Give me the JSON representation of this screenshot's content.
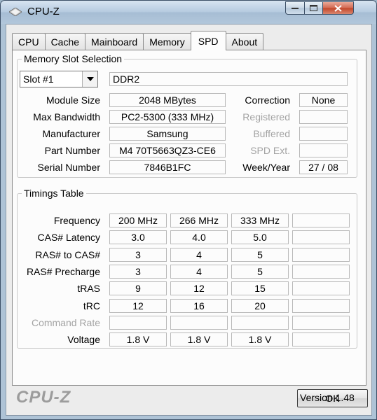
{
  "window": {
    "title": "CPU-Z",
    "controls": {
      "minimize": "—",
      "maximize": "□",
      "close": "✕"
    }
  },
  "tabs": [
    "CPU",
    "Cache",
    "Mainboard",
    "Memory",
    "SPD",
    "About"
  ],
  "active_tab": "SPD",
  "slot_section": {
    "title": "Memory Slot Selection",
    "slot_selected": "Slot #1",
    "slot_type": "DDR2",
    "fields": {
      "module_size_label": "Module Size",
      "module_size": "2048 MBytes",
      "max_bandwidth_label": "Max Bandwidth",
      "max_bandwidth": "PC2-5300 (333 MHz)",
      "manufacturer_label": "Manufacturer",
      "manufacturer": "Samsung",
      "part_number_label": "Part Number",
      "part_number": "M4 70T5663QZ3-CE6",
      "serial_number_label": "Serial Number",
      "serial_number": "7846B1FC",
      "correction_label": "Correction",
      "correction": "None",
      "registered_label": "Registered",
      "registered": "",
      "buffered_label": "Buffered",
      "buffered": "",
      "spd_ext_label": "SPD Ext.",
      "spd_ext": "",
      "week_year_label": "Week/Year",
      "week_year": "27 / 08"
    }
  },
  "timings": {
    "title": "Timings Table",
    "rows": [
      {
        "label": "Frequency",
        "values": [
          "200 MHz",
          "266 MHz",
          "333 MHz",
          ""
        ],
        "dim": false
      },
      {
        "label": "CAS# Latency",
        "values": [
          "3.0",
          "4.0",
          "5.0",
          ""
        ],
        "dim": false
      },
      {
        "label": "RAS# to CAS#",
        "values": [
          "3",
          "4",
          "5",
          ""
        ],
        "dim": false
      },
      {
        "label": "RAS# Precharge",
        "values": [
          "3",
          "4",
          "5",
          ""
        ],
        "dim": false
      },
      {
        "label": "tRAS",
        "values": [
          "9",
          "12",
          "15",
          ""
        ],
        "dim": false
      },
      {
        "label": "tRC",
        "values": [
          "12",
          "16",
          "20",
          ""
        ],
        "dim": false
      },
      {
        "label": "Command Rate",
        "values": [
          "",
          "",
          "",
          ""
        ],
        "dim": true
      },
      {
        "label": "Voltage",
        "values": [
          "1.8 V",
          "1.8 V",
          "1.8 V",
          ""
        ],
        "dim": false
      }
    ]
  },
  "version": "Version 1.48",
  "footer_logo": "CPU-Z",
  "ok_label": "OK"
}
